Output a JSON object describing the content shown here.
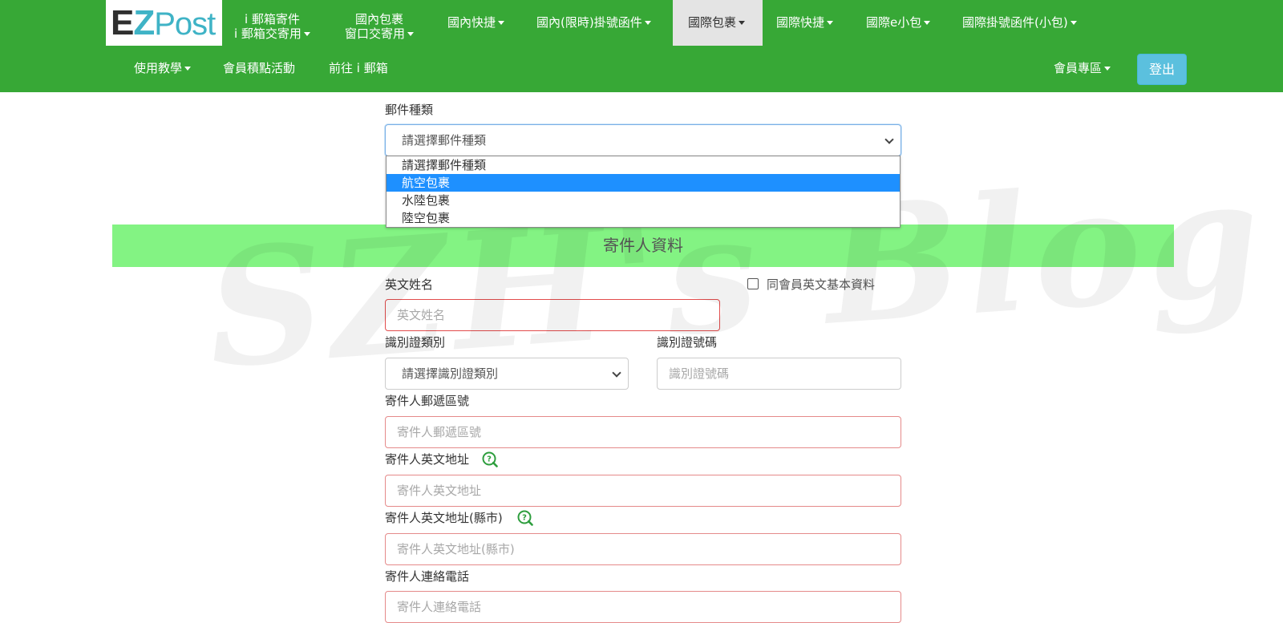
{
  "logo": {
    "ez": "E",
    "z": "Z",
    "post": "Post"
  },
  "nav_top": [
    {
      "line1": "i 郵箱寄件",
      "line2": "i 郵箱交寄用"
    },
    {
      "line1": "國內包裹",
      "line2": "窗口交寄用"
    },
    {
      "label": "國內快捷"
    },
    {
      "label": "國內(限時)掛號函件"
    },
    {
      "label": "國際包裹",
      "active": true
    },
    {
      "label": "國際快捷"
    },
    {
      "label": "國際e小包"
    },
    {
      "label": "國際掛號函件(小包)"
    }
  ],
  "nav_bottom": [
    {
      "label": "使用教學"
    },
    {
      "label": "會員積點活動"
    },
    {
      "label": "前往 i 郵箱"
    }
  ],
  "member_menu": {
    "label": "會員專區"
  },
  "logout_label": "登出",
  "watermark": "SZH's Blog",
  "mail_type": {
    "label": "郵件種類",
    "selected": "請選擇郵件種類",
    "options": [
      "請選擇郵件種類",
      "航空包裹",
      "水陸包裹",
      "陸空包裹"
    ],
    "highlighted": "航空包裹"
  },
  "section_title": "寄件人資料",
  "sender": {
    "english_name": {
      "label": "英文姓名",
      "placeholder": "英文姓名"
    },
    "same_as_member": "同會員英文基本資料",
    "id_type": {
      "label": "識別證類別",
      "selected": "請選擇識別證類別"
    },
    "id_number": {
      "label": "識別證號碼",
      "placeholder": "識別證號碼"
    },
    "zip": {
      "label": "寄件人郵遞區號",
      "placeholder": "寄件人郵遞區號"
    },
    "address": {
      "label": "寄件人英文地址",
      "placeholder": "寄件人英文地址"
    },
    "city": {
      "label": "寄件人英文地址(縣市)",
      "placeholder": "寄件人英文地址(縣市)"
    },
    "phone": {
      "label": "寄件人連絡電話",
      "placeholder": "寄件人連絡電話"
    }
  },
  "colors": {
    "navbar": "#37a836",
    "banner": "#83f383",
    "logout": "#5bc0de",
    "highlight": "#1e90ff",
    "error_border": "#e24c4c",
    "help_icon": "#2e9e3e"
  }
}
